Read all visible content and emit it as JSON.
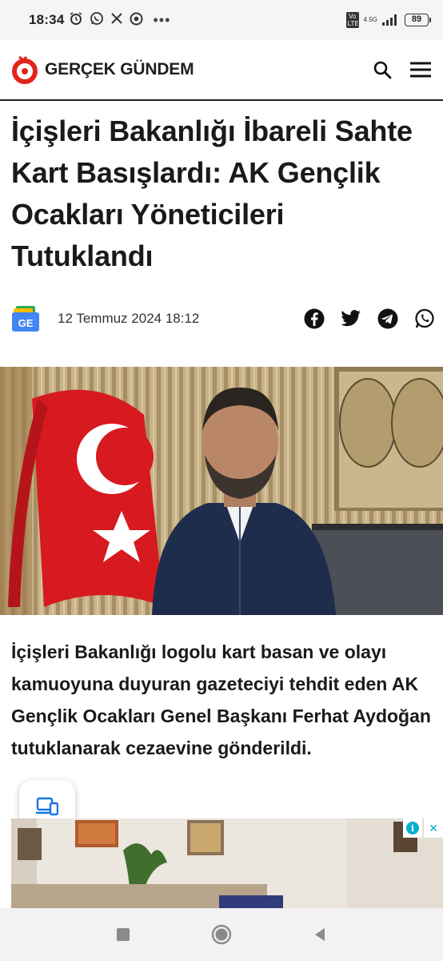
{
  "status": {
    "time": "18:34",
    "left_icons": [
      "alarm-icon",
      "whatsapp-icon",
      "x-icon",
      "chrome-icon"
    ],
    "more": "•••",
    "volte": "Vo LTE",
    "network": "4.5G",
    "battery": "89"
  },
  "site": {
    "name": "GERÇEK GÜNDEM",
    "brand_color": "#e1251b",
    "search_icon": "search-icon",
    "menu_icon": "hamburger-menu-icon"
  },
  "article": {
    "title": "İçişleri Bakanlığı İbareli Sahte Kart Basışlardı: AK Gençlik Ocakları Yöneticileri Tutuklandı",
    "date": "12 Temmuz 2024 18:12",
    "lead": "İçişleri Bakanlığı logolu kart basan ve olayı kamuoyuna duyuran gazeteciyi tehdit eden AK Gençlik Ocakları Genel Başkanı Ferhat Aydoğan tutuklanarak cezaevine gönderildi.",
    "share_icons": [
      "facebook-icon",
      "twitter-icon",
      "telegram-icon",
      "whatsapp-icon"
    ]
  },
  "google_news": {
    "label": "GE"
  },
  "ad": {
    "info": "i",
    "close": "✕"
  }
}
